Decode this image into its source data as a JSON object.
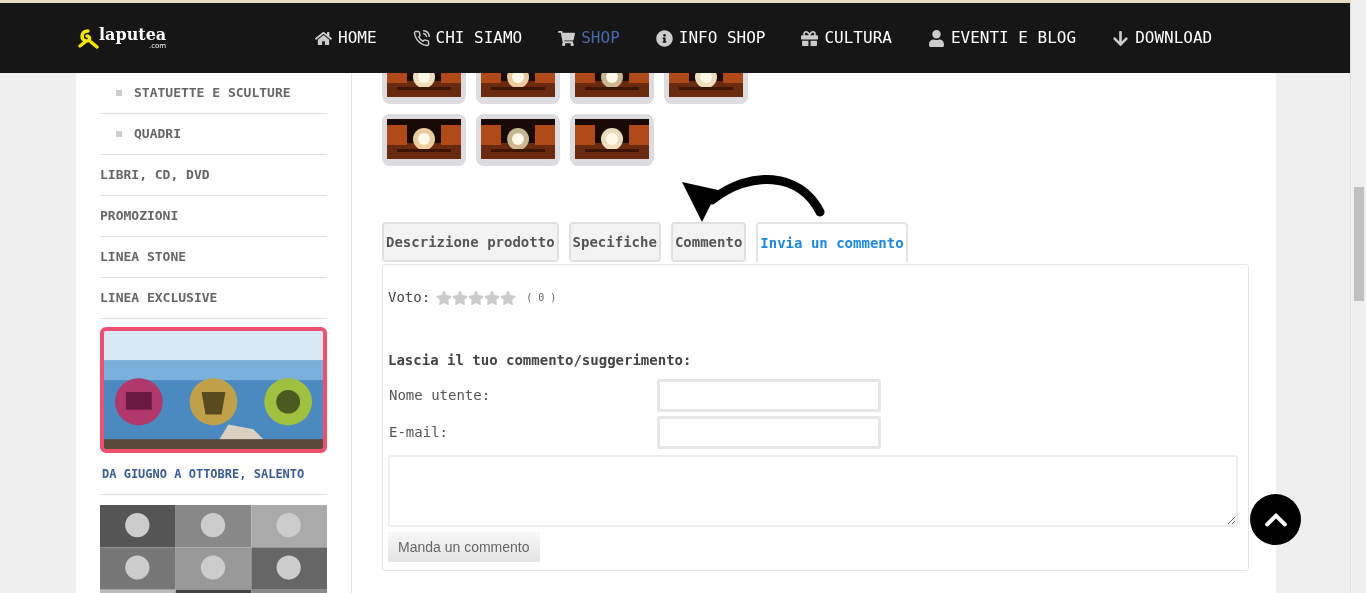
{
  "nav": {
    "logo": "laputea",
    "logo_suffix": ".com",
    "items": [
      {
        "label": "HOME",
        "selected": false
      },
      {
        "label": "CHI SIAMO",
        "selected": false
      },
      {
        "label": "SHOP",
        "selected": true
      },
      {
        "label": "INFO SHOP",
        "selected": false
      },
      {
        "label": "CULTURA",
        "selected": false
      },
      {
        "label": "EVENTI E BLOG",
        "selected": false
      },
      {
        "label": "DOWNLOAD",
        "selected": false
      }
    ]
  },
  "sidebar": {
    "items": [
      {
        "label": "STATUETTE E SCULTURE",
        "kind": "sub"
      },
      {
        "label": "QUADRI",
        "kind": "sub"
      },
      {
        "label": "LIBRI, CD, DVD",
        "kind": "top"
      },
      {
        "label": "PROMOZIONI",
        "kind": "top"
      },
      {
        "label": "LINEA STONE",
        "kind": "top"
      },
      {
        "label": "LINEA EXCLUSIVE",
        "kind": "top"
      }
    ],
    "banner": {
      "kind": "picture",
      "caption": "DA GIUGNO A OTTOBRE, SALENTO"
    }
  },
  "tabs": [
    {
      "label": "Descrizione prodotto",
      "selected": false
    },
    {
      "label": "Specifiche",
      "selected": false
    },
    {
      "label": "Commento",
      "selected": false
    },
    {
      "label": "Invia un commento",
      "selected": true
    }
  ],
  "review": {
    "vote_label": "Voto:",
    "stars": 0,
    "vote_count": "( 0 )",
    "heading": "Lascia il tuo commento/suggerimento:",
    "fields": [
      {
        "label": "Nome utente:"
      },
      {
        "label": "E-mail:"
      }
    ],
    "submit": "Manda un commento"
  }
}
